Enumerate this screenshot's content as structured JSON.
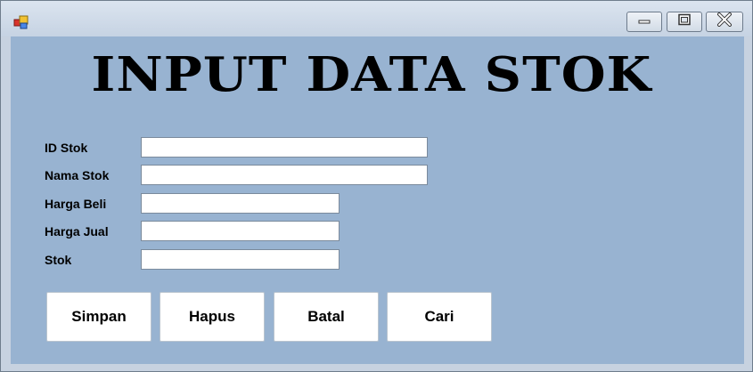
{
  "window": {
    "icon": "app-icon",
    "controls": {
      "minimize": "minimize-icon",
      "maximize": "maximize-icon",
      "close": "close-icon"
    }
  },
  "form": {
    "title": "INPUT DATA STOK",
    "fields": [
      {
        "label": "ID Stok",
        "value": ""
      },
      {
        "label": "Nama Stok",
        "value": ""
      },
      {
        "label": "Harga Beli",
        "value": ""
      },
      {
        "label": "Harga Jual",
        "value": ""
      },
      {
        "label": "Stok",
        "value": ""
      }
    ],
    "buttons": {
      "simpan": "Simpan",
      "hapus": "Hapus",
      "batal": "Batal",
      "cari": "Cari"
    }
  },
  "colors": {
    "client_background": "#98b3d1",
    "title_text": "#000000"
  }
}
